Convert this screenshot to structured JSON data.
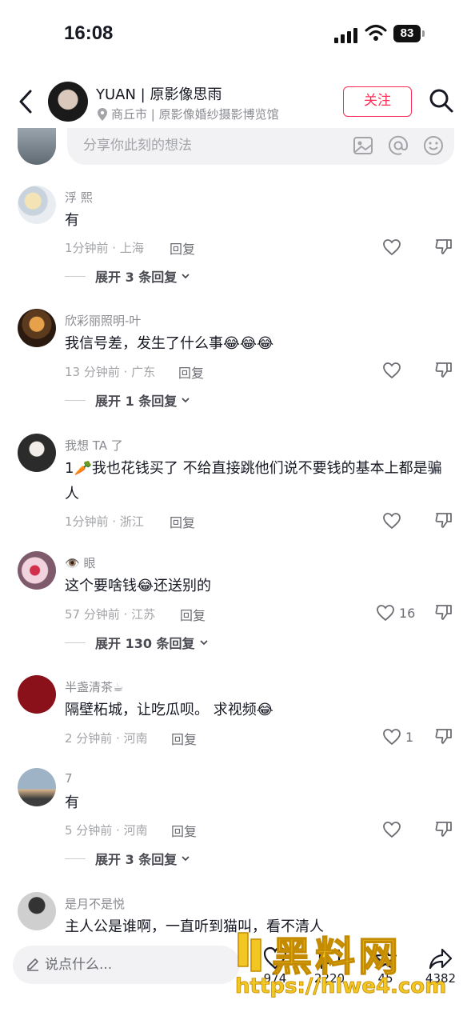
{
  "status": {
    "time": "16:08",
    "battery": "83"
  },
  "header": {
    "name": "YUAN | 原影像思雨",
    "location": "商丘市 | 原影像婚纱摄影博览馆",
    "follow_label": "关注"
  },
  "share": {
    "placeholder": "分享你此刻的想法"
  },
  "comments": [
    {
      "user": "浮 熙",
      "text": "有",
      "meta": "1分钟前 · 上海",
      "reply": "回复",
      "likes": "",
      "expand": "展开 3 条回复"
    },
    {
      "user": "欣彩丽照明-叶",
      "text": "我信号差，发生了什么事😂😂😂",
      "meta": "13 分钟前 · 广东",
      "reply": "回复",
      "likes": "",
      "expand": "展开 1 条回复"
    },
    {
      "user": "我想 TA 了",
      "text": "1🥕我也花钱买了 不给直接跳他们说不要钱的基本上都是骗人",
      "meta": "1分钟前 · 浙江",
      "reply": "回复",
      "likes": "",
      "expand": ""
    },
    {
      "user": "👁️ 眼",
      "text": "这个要啥钱😂还送别的",
      "meta": "57 分钟前 · 江苏",
      "reply": "回复",
      "likes": "16",
      "expand": "展开 130 条回复"
    },
    {
      "user": "半盏清茶☕",
      "text": "隔壁柘城，让吃瓜呗。 求视频😂",
      "meta": "2 分钟前 · 河南",
      "reply": "回复",
      "likes": "1",
      "expand": ""
    },
    {
      "user": "7",
      "text": "有",
      "meta": "5 分钟前 · 河南",
      "reply": "回复",
      "likes": "",
      "expand": "展开 3 条回复"
    },
    {
      "user": "是月不是悦",
      "text": "主人公是谁啊，一直听到猫叫，看不清人",
      "meta": "",
      "reply": "",
      "likes": "",
      "expand": ""
    }
  ],
  "bottom": {
    "say_placeholder": "说点什么...",
    "likes": "974",
    "comments": "2220",
    "favorites": "45",
    "shares": "4382"
  },
  "watermark": {
    "title": "黑料网",
    "url": "https://hlwe4.com"
  }
}
